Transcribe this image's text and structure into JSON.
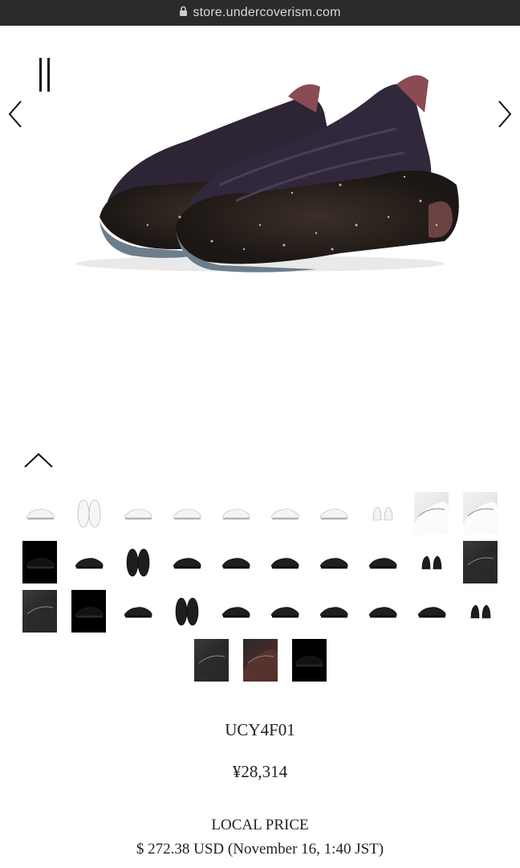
{
  "browser": {
    "url": "store.undercoverism.com"
  },
  "gallery": {
    "prev_icon": "chevron-left",
    "next_icon": "chevron-right",
    "pause_icon": "pause",
    "collapse_icon": "chevron-up"
  },
  "thumbnails": {
    "rows": [
      [
        "white",
        "white-top",
        "white",
        "white",
        "white",
        "white",
        "white",
        "white-pair",
        "white-closeup",
        "white-closeup"
      ],
      [
        "dark-black-bg",
        "dark",
        "dark-top",
        "dark",
        "dark",
        "dark",
        "dark",
        "dark",
        "dark-pair",
        "dark-closeup"
      ],
      [
        "dark-closeup",
        "dark-black-bg",
        "dark",
        "dark-top",
        "dark",
        "dark",
        "dark",
        "dark",
        "dark",
        "dark-pair"
      ],
      [
        "dark-closeup",
        "dark-closeup-red",
        "dark-black-bg"
      ]
    ]
  },
  "product": {
    "sku": "UCY4F01",
    "price": "¥28,314",
    "local_price_label": "LOCAL PRICE",
    "local_price_value": "$ 272.38 USD (November 16, 1:40 JST)"
  }
}
